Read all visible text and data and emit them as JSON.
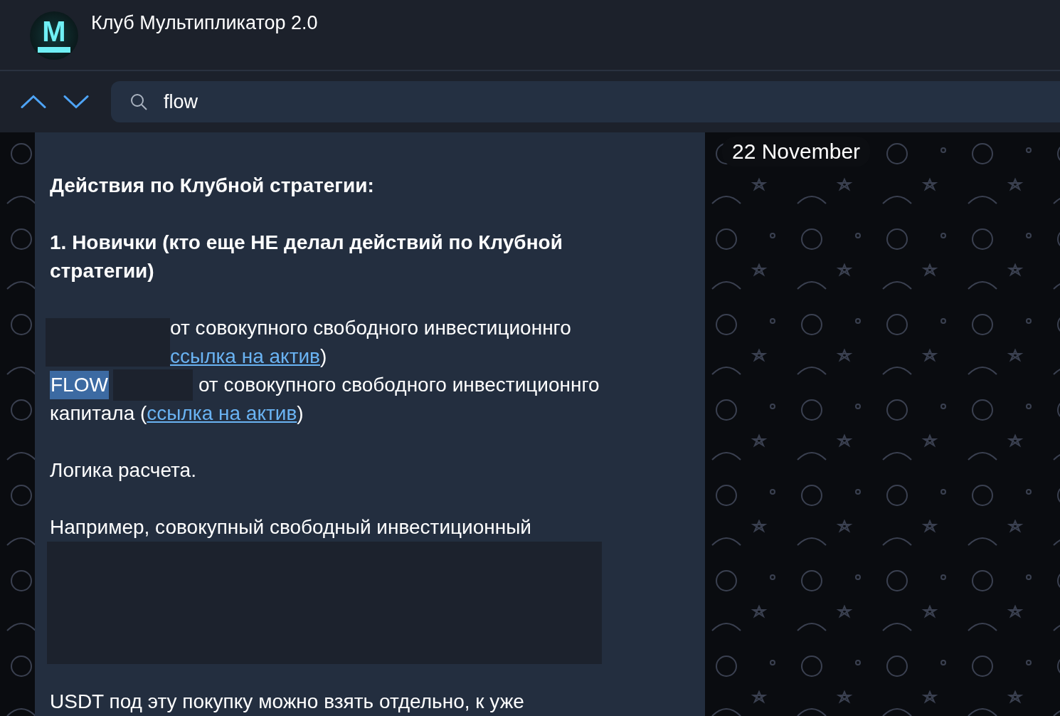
{
  "chat": {
    "title": "Клуб Мультипликатор 2.0",
    "avatar_letter": "M"
  },
  "search": {
    "query": "flow"
  },
  "date_badge": "22 November",
  "message": {
    "heading": "Действия по Клубной стратегии:",
    "newcomers": "1. Новички (кто еще НЕ делал действий по Клубной стратегии)",
    "item_1": {
      "text": "от совокупного свободного инвестиционнго",
      "link": "ссылка на актив",
      "close": ")"
    },
    "item_2": {
      "highlight": "FLOW",
      "text": "от совокупного свободного инвестиционнго",
      "continuation": "капитала (",
      "link": "ссылка на актив",
      "close": ")"
    },
    "logic": "Логика расчета.",
    "example": "Например, совокупный свободный инвестиционный",
    "footer": "USDT под эту покупку можно взять отдельно, к уже"
  }
}
